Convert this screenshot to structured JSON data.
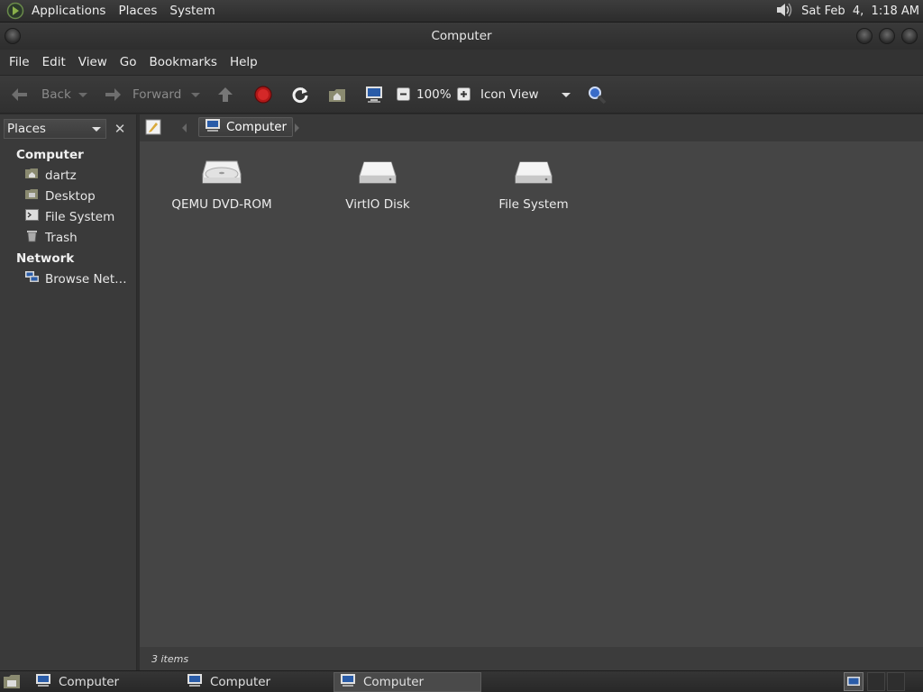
{
  "top_panel": {
    "menus": [
      "Applications",
      "Places",
      "System"
    ],
    "clock": "Sat Feb  4,  1:18 AM",
    "icons": {
      "logo": "gnome-foot-icon",
      "volume": "volume-icon"
    }
  },
  "window": {
    "title": "Computer"
  },
  "menubar": [
    "File",
    "Edit",
    "View",
    "Go",
    "Bookmarks",
    "Help"
  ],
  "toolbar": {
    "back_label": "Back",
    "forward_label": "Forward",
    "zoom": "100%",
    "view_mode": "Icon View",
    "icons": [
      "back-arrow-icon",
      "forward-arrow-icon",
      "up-icon",
      "stop-icon",
      "reload-icon",
      "home-icon",
      "computer-icon",
      "zoom-out-icon",
      "zoom-in-icon",
      "search-icon"
    ]
  },
  "location": {
    "crumb": "Computer"
  },
  "sidebar": {
    "selector_label": "Places",
    "sections": [
      {
        "title": "Computer",
        "items": [
          {
            "label": "dartz",
            "icon": "home-folder-icon"
          },
          {
            "label": "Desktop",
            "icon": "desktop-folder-icon"
          },
          {
            "label": "File System",
            "icon": "filesystem-icon"
          },
          {
            "label": "Trash",
            "icon": "trash-icon"
          }
        ]
      },
      {
        "title": "Network",
        "items": [
          {
            "label": "Browse Net…",
            "icon": "network-icon"
          }
        ]
      }
    ]
  },
  "items": [
    {
      "label": "QEMU DVD-ROM",
      "icon": "optical-drive-icon"
    },
    {
      "label": "VirtIO Disk",
      "icon": "hard-disk-icon"
    },
    {
      "label": "File System",
      "icon": "hard-disk-icon"
    }
  ],
  "status": "3 items",
  "taskbar": {
    "tasks": [
      {
        "label": "Computer",
        "active": false
      },
      {
        "label": "Computer",
        "active": false
      },
      {
        "label": "Computer",
        "active": true
      }
    ]
  },
  "colors": {
    "background": "#454545",
    "panel": "#333333",
    "stop": "#c02020",
    "accent": "#4f7fcf"
  }
}
